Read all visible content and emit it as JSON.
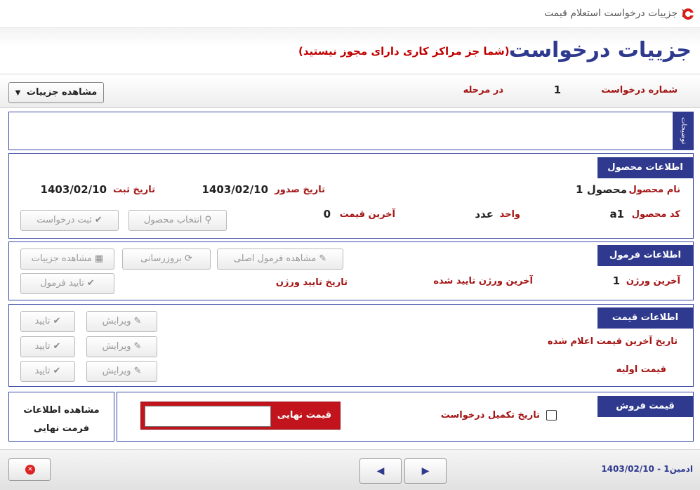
{
  "window": {
    "title": "جزییات درخواست استعلام قیمت"
  },
  "header": {
    "title": "جزییات درخواست",
    "subtitle": "(شما جز مراکز کاری دارای مجوز نیستید)"
  },
  "request": {
    "number_label": "شماره درخواست",
    "number_value": "1",
    "stage_label": "در مرحله",
    "stage_value": "",
    "view_details_button": "مشاهده جزییات"
  },
  "description": {
    "tab_label": "توضیحات",
    "value": ""
  },
  "product_info": {
    "title": "اطلاعات محصول",
    "name_label": "نام محصول",
    "name_value": "محصول 1",
    "issue_date_label": "تاریخ صدور",
    "issue_date_value": "1403/02/10",
    "register_date_label": "تاریخ ثبت",
    "register_date_value": "1403/02/10",
    "code_label": "کد محصول",
    "code_value": "a1",
    "unit_label": "واحد",
    "unit_value": "عدد",
    "last_price_label": "آخرین قیمت",
    "last_price_value": "0",
    "select_product_button": "انتخاب محصول",
    "submit_request_button": "ثبت درخواست"
  },
  "formula_info": {
    "title": "اطلاعات فرمول",
    "view_original_button": "مشاهده فرمول اصلی",
    "update_button": "بروزرسانی",
    "view_details_button": "مشاهده جزییات",
    "approve_button": "تایید فرمول",
    "last_version_label": "آخرین ورژن",
    "last_version_value": "1",
    "last_approved_label": "آخرین ورژن تایید شده",
    "approve_date_label": "تاریخ تایید ورژن"
  },
  "price_info": {
    "title": "اطلاعات قیمت",
    "last_announced_label": "تاریخ آخرین قیمت اعلام شده",
    "initial_price_label": "قیمت اولیه",
    "edit_label": "ویرایش",
    "approve_label": "تایید"
  },
  "sale_price": {
    "title": "قیمت فروش",
    "completion_label": "تاریخ تکمیل درخواست",
    "final_price_label": "قیمت نهایی",
    "final_price_value": "",
    "view_final_line1": "مشاهده اطلاعات",
    "view_final_line2": "فرمت نهایی"
  },
  "footer": {
    "info": "ادمین1 - 1403/02/10"
  }
}
